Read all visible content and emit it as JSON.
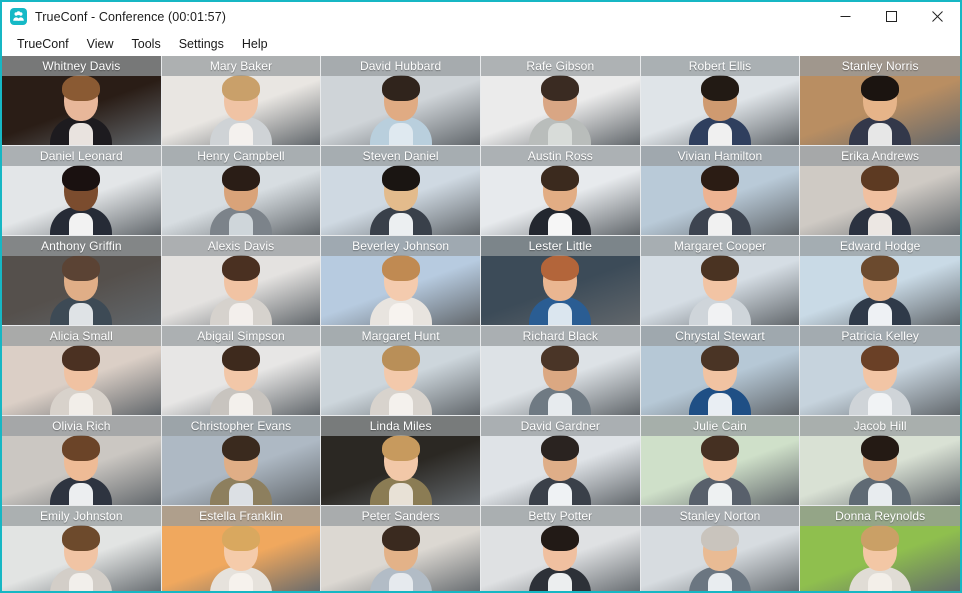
{
  "window": {
    "title": "TrueConf - Conference (00:01:57)",
    "app_name": "TrueConf",
    "conference_label": "Conference",
    "elapsed_time": "00:01:57",
    "icon": "trueconf-group-icon",
    "border_color": "#16b7c4",
    "controls": {
      "minimize": "minimize-icon",
      "maximize": "maximize-icon",
      "close": "close-icon"
    }
  },
  "menubar": {
    "items": [
      {
        "label": "TrueConf"
      },
      {
        "label": "View"
      },
      {
        "label": "Tools"
      },
      {
        "label": "Settings"
      },
      {
        "label": "Help"
      }
    ]
  },
  "grid": {
    "columns": 6,
    "rows": 6,
    "name_bar_color": "#969b9e",
    "name_text_color": "#ffffff",
    "participants": [
      {
        "name": "Whitney Davis",
        "bg": "#2a1d16",
        "skin": "#e8b79a",
        "hair": "#8a5a33",
        "body": "#1d1b1f",
        "shirt": "#e9e3df"
      },
      {
        "name": "Mary Baker",
        "bg": "#e9e6e2",
        "skin": "#f0c3a4",
        "hair": "#c9a06a",
        "body": "#cfd3d6",
        "shirt": "#f4f1ee"
      },
      {
        "name": "David Hubbard",
        "bg": "#cfd4d8",
        "skin": "#e0ab83",
        "hair": "#30241c",
        "body": "#b9cfdd",
        "shirt": "#dfe9f0"
      },
      {
        "name": "Rafe Gibson",
        "bg": "#ebebeb",
        "skin": "#d9a684",
        "hair": "#3a2b22",
        "body": "#b9bdbb",
        "shirt": "#d8dcd9"
      },
      {
        "name": "Robert Ellis",
        "bg": "#dfe4e8",
        "skin": "#cf9a70",
        "hair": "#221a14",
        "body": "#2f3f5e",
        "shirt": "#f0f0f0"
      },
      {
        "name": "Stanley Norris",
        "bg": "#b98e62",
        "skin": "#e6b489",
        "hair": "#1b1410",
        "body": "#33384a",
        "shirt": "#e7e7e7"
      },
      {
        "name": "Daniel Leonard",
        "bg": "#e3e6e8",
        "skin": "#7b4c2e",
        "hair": "#1a1110",
        "body": "#262b36",
        "shirt": "#f2f2f2"
      },
      {
        "name": "Henry Campbell",
        "bg": "#d7dde1",
        "skin": "#d9a379",
        "hair": "#2a1d16",
        "body": "#7c838a",
        "shirt": "#cfd6da"
      },
      {
        "name": "Steven Daniel",
        "bg": "#cfd9e2",
        "skin": "#e3bb8c",
        "hair": "#1a1512",
        "body": "#39404a",
        "shirt": "#eceff1"
      },
      {
        "name": "Austin Ross",
        "bg": "#e7eaed",
        "skin": "#e2ad84",
        "hair": "#3b2a1e",
        "body": "#23272f",
        "shirt": "#f6f6f6"
      },
      {
        "name": "Vivian Hamilton",
        "bg": "#b9cad8",
        "skin": "#edb392",
        "hair": "#2b1c14",
        "body": "#3d4450",
        "shirt": "#f1f1f1"
      },
      {
        "name": "Erika Andrews",
        "bg": "#cfcac4",
        "skin": "#f0c0a0",
        "hair": "#5d3a22",
        "body": "#2b3240",
        "shirt": "#ece7e3"
      },
      {
        "name": "Anthony Griffin",
        "bg": "#55504c",
        "skin": "#e0ae87",
        "hair": "#5b4334",
        "body": "#3d4a55",
        "shirt": "#dfe3e6"
      },
      {
        "name": "Alexis Davis",
        "bg": "#e4e2e0",
        "skin": "#f1c3a3",
        "hair": "#4a3021",
        "body": "#d6d2cd",
        "shirt": "#f3efec"
      },
      {
        "name": "Beverley Johnson",
        "bg": "#b7cbe0",
        "skin": "#f4cbae",
        "hair": "#c08a52",
        "body": "#e8e4df",
        "shirt": "#f7f3ef"
      },
      {
        "name": "Lester Little",
        "bg": "#3c4b58",
        "skin": "#eab691",
        "hair": "#b3653a",
        "body": "#2a5d93",
        "shirt": "#dbe6ef"
      },
      {
        "name": "Margaret Cooper",
        "bg": "#d5dde4",
        "skin": "#f2c4a4",
        "hair": "#4a3322",
        "body": "#cfd5da",
        "shirt": "#f1f2f3"
      },
      {
        "name": "Edward Hodge",
        "bg": "#c9dae6",
        "skin": "#e8b68f",
        "hair": "#6b4a2e",
        "body": "#2f3a49",
        "shirt": "#eef1f4"
      },
      {
        "name": "Alicia Small",
        "bg": "#dbcfc6",
        "skin": "#f0c2a2",
        "hair": "#4b3122",
        "body": "#d8d2cb",
        "shirt": "#f2eee9"
      },
      {
        "name": "Abigail Simpson",
        "bg": "#e7e6e5",
        "skin": "#f2c7a8",
        "hair": "#3e2a1d",
        "body": "#c8c4bf",
        "shirt": "#f3f0ec"
      },
      {
        "name": "Margaret Hunt",
        "bg": "#cdd6dc",
        "skin": "#f3c9ab",
        "hair": "#b98f58",
        "body": "#d8d3cd",
        "shirt": "#f4f1ed"
      },
      {
        "name": "Richard Black",
        "bg": "#dde2e6",
        "skin": "#dba882",
        "hair": "#4a3527",
        "body": "#6f7a83",
        "shirt": "#e7ebee"
      },
      {
        "name": "Chrystal Stewart",
        "bg": "#b6c8d6",
        "skin": "#f1c3a2",
        "hair": "#4a3425",
        "body": "#1f4f85",
        "shirt": "#e9eef3"
      },
      {
        "name": "Patricia Kelley",
        "bg": "#c6d3dd",
        "skin": "#f2c5a5",
        "hair": "#6a4026",
        "body": "#cfd4d8",
        "shirt": "#f1f3f5"
      },
      {
        "name": "Olivia Rich",
        "bg": "#cbc7c2",
        "skin": "#eebb96",
        "hair": "#6b4428",
        "body": "#2e3440",
        "shirt": "#eceef0"
      },
      {
        "name": "Christopher Evans",
        "bg": "#aeb9c4",
        "skin": "#e0ae86",
        "hair": "#3a2a1e",
        "body": "#8d7f5e",
        "shirt": "#dce0e4"
      },
      {
        "name": "Linda Miles",
        "bg": "#2b2823",
        "skin": "#f2c8a8",
        "hair": "#c79a5e",
        "body": "#8b7c54",
        "shirt": "#e8e1d6"
      },
      {
        "name": "David Gardner",
        "bg": "#dfe3e7",
        "skin": "#dfae88",
        "hair": "#2a2320",
        "body": "#3a4049",
        "shirt": "#eff2f4"
      },
      {
        "name": "Julie Cain",
        "bg": "#cfe0c9",
        "skin": "#f3c7a6",
        "hair": "#453022",
        "body": "#58606b",
        "shirt": "#eef1f2"
      },
      {
        "name": "Jacob Hill",
        "bg": "#d9e1d4",
        "skin": "#d8a67f",
        "hair": "#241a14",
        "body": "#5f6a74",
        "shirt": "#e8ecef"
      },
      {
        "name": "Emily Johnston",
        "bg": "#e2e4e3",
        "skin": "#f1c4a4",
        "hair": "#6d4a2c",
        "body": "#d3cec8",
        "shirt": "#f2efeb"
      },
      {
        "name": "Estella Franklin",
        "bg": "#f0a85e",
        "skin": "#f5cbaa",
        "hair": "#d9a85f",
        "body": "#e6e2dc",
        "shirt": "#f6f2ed"
      },
      {
        "name": "Peter Sanders",
        "bg": "#dcd8d2",
        "skin": "#e3b288",
        "hair": "#3a2a1f",
        "body": "#b2bcc6",
        "shirt": "#e6eaee"
      },
      {
        "name": "Betty Potter",
        "bg": "#dfe1e3",
        "skin": "#f0c0a0",
        "hair": "#221a16",
        "body": "#2d3138",
        "shirt": "#eceeef"
      },
      {
        "name": "Stanley Norton",
        "bg": "#d7dce0",
        "skin": "#e9bb94",
        "hair": "#c9c4bd",
        "body": "#6b7681",
        "shirt": "#e9edf0"
      },
      {
        "name": "Donna Reynolds",
        "bg": "#8fbf4e",
        "skin": "#f3c7a5",
        "hair": "#caa066",
        "body": "#e0dcd5",
        "shirt": "#f3efe9"
      }
    ]
  }
}
